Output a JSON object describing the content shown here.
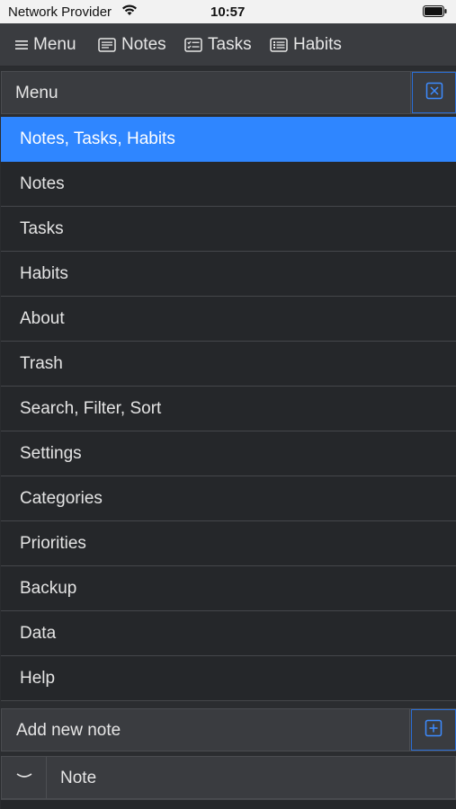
{
  "status_bar": {
    "carrier": "Network Provider",
    "time": "10:57",
    "icons": [
      "wifi-icon",
      "battery-icon"
    ]
  },
  "top_nav": {
    "menu_label": "Menu",
    "notes_label": "Notes",
    "tasks_label": "Tasks",
    "habits_label": "Habits",
    "icons": [
      "hamburger-icon",
      "note-icon",
      "task-icon",
      "habit-icon"
    ]
  },
  "menu_panel": {
    "title": "Menu",
    "close_icon": "close-icon",
    "accent_color": "#2f86ff",
    "items": [
      {
        "label": "Notes, Tasks, Habits",
        "active": true
      },
      {
        "label": "Notes"
      },
      {
        "label": "Tasks"
      },
      {
        "label": "Habits"
      },
      {
        "label": "About"
      },
      {
        "label": "Trash"
      },
      {
        "label": "Search, Filter, Sort"
      },
      {
        "label": "Settings"
      },
      {
        "label": "Categories"
      },
      {
        "label": "Priorities"
      },
      {
        "label": "Backup"
      },
      {
        "label": "Data"
      },
      {
        "label": "Help"
      }
    ]
  },
  "add_note": {
    "label": "Add new note",
    "add_icon": "plus-square-icon"
  },
  "note_row": {
    "label": "Note",
    "expand_icon": "chevron-down-icon"
  }
}
